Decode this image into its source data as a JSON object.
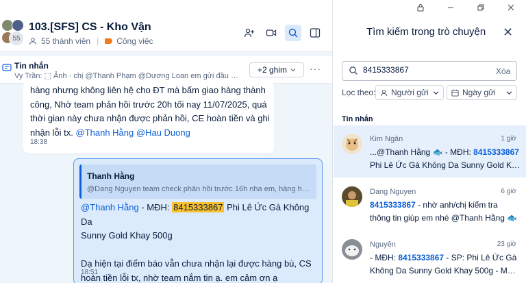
{
  "group": {
    "title": "103.[SFS] CS - Kho Vận",
    "avatar_count": "55",
    "members": "55 thành viên",
    "tag": "Công việc"
  },
  "pinned": {
    "title": "Tin nhắn",
    "text": "Vy Trần: ⬚ Ảnh · chị @Thanh Phạm @Dương Loan em gửi đầu mối...",
    "count_label": "+2 ghim"
  },
  "message1": {
    "line1": "hàng nhưng không liên hệ cho ĐT mà bấm giao hàng thành",
    "line2": "công, Nhờ team phản hồi trước 20h tối nay 11/07/2025, quá",
    "line3": "thời gian này chưa nhận được phản hồi, CE hoàn tiền và ghi",
    "line4_prefix": "nhận lỗi tx. ",
    "mention1": "@Thanh Hằng",
    "mention2": "@Hau Duong",
    "time": "18:38"
  },
  "message2": {
    "quote_name": "Thanh Hằng",
    "quote_text": "@Dang Nguyen team check phản hồi trước 16h nha em, hàng hôm...",
    "mention": "@Thanh Hằng",
    "label": " - MĐH: ",
    "order_code": "8415333867",
    "product": " Phi Lê Ức Gà Không Da",
    "product2": "Sunny Gold Khay 500g",
    "body1": "Dạ hiện tại điểm báo vẫn chưa nhận lại được hàng bù, CS",
    "body2": "hoàn tiền lỗi tx, nhờ team nắm tin ạ. em cảm ơn ạ",
    "time": "18:51"
  },
  "search_panel": {
    "title": "Tìm kiếm trong trò chuyện",
    "query": "8415333867",
    "clear": "Xóa",
    "filter_label": "Lọc theo:",
    "filter_sender": "Người gửi",
    "filter_date": "Ngày gửi",
    "section": "Tin nhắn"
  },
  "results": [
    {
      "name": "Kim Ngân",
      "time": "1 giờ",
      "l1_prefix": "...@Thanh Hằng 🐟 - MĐH: ",
      "l1_kw": "8415333867",
      "l2": "Phi Lê Ức Gà Không Da Sunny Gold Khay 500g"
    },
    {
      "name": "Dang Nguyen",
      "time": "6 giờ",
      "l1_kw": "8415333867",
      "l1_suffix": " - nhờ anh/chị kiểm tra",
      "l2": "thông tin giúp em nhé @Thanh Hằng 🐟"
    },
    {
      "name": "Nguyên",
      "time": "23 giờ",
      "l1_prefix": "- MĐH: ",
      "l1_kw": "8415333867",
      "l1_suffix": " - SP: Phi Lê Ức Gà",
      "l2": "Không Da Sunny Gold Khay 500g - MBS:..."
    }
  ],
  "colors": {
    "accent": "#0b5ed7",
    "highlight": "#f9c12e",
    "tag": "#f27b1e"
  }
}
